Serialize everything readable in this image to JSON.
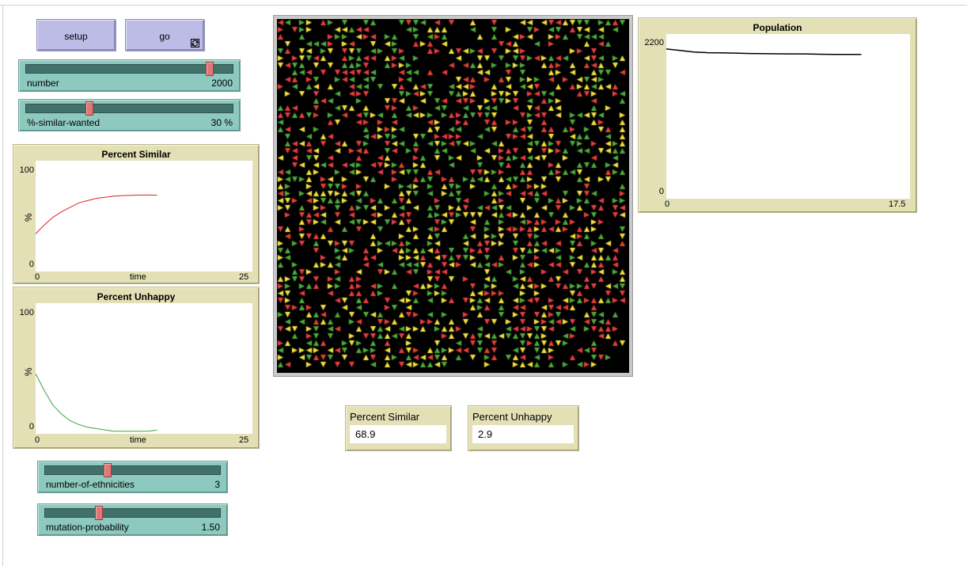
{
  "buttons": {
    "setup_label": "setup",
    "go_label": "go",
    "go_forever_icon": "forever-arrows-icon"
  },
  "sliders": {
    "number": {
      "name": "number",
      "value": "2000",
      "fraction": 0.9
    },
    "similar_wanted": {
      "name": "%-similar-wanted",
      "value": "30 %",
      "fraction": 0.3
    },
    "ethnicities": {
      "name": "number-of-ethnicities",
      "value": "3",
      "fraction": 0.35
    },
    "mutation": {
      "name": "mutation-probability",
      "value": "1.50",
      "fraction": 0.3
    }
  },
  "plots": {
    "percent_similar": {
      "title": "Percent Similar",
      "ylabel": "%",
      "xlabel": "time",
      "ymin": "0",
      "ymax": "100",
      "xmin": "0",
      "xmax": "25",
      "color": "#e02020"
    },
    "percent_unhappy": {
      "title": "Percent Unhappy",
      "ylabel": "%",
      "xlabel": "time",
      "ymin": "0",
      "ymax": "100",
      "xmin": "0",
      "xmax": "25",
      "color": "#3aa33a"
    },
    "population": {
      "title": "Population",
      "ymin": "0",
      "ymax": "2200",
      "xmin": "0",
      "xmax": "17.5",
      "color": "#000000"
    }
  },
  "monitors": {
    "percent_similar": {
      "label": "Percent Similar",
      "value": "68.9"
    },
    "percent_unhappy": {
      "label": "Percent Unhappy",
      "value": "2.9"
    }
  },
  "world": {
    "background": "#000000",
    "turtle_colors": [
      "#e83c3c",
      "#f2e03c",
      "#4caa3c"
    ]
  },
  "chart_data": [
    {
      "type": "line",
      "title": "Percent Similar",
      "xlabel": "time",
      "ylabel": "%",
      "xlim": [
        0,
        25
      ],
      "ylim": [
        0,
        100
      ],
      "series": [
        {
          "color": "#e02020",
          "x": [
            0,
            1,
            2,
            3,
            4,
            5,
            6,
            7,
            8,
            9,
            10,
            11,
            12,
            13,
            14
          ],
          "y": [
            34,
            42,
            49,
            54,
            58,
            62,
            64,
            66,
            67,
            68,
            68.5,
            68.8,
            69,
            69,
            68.9
          ]
        }
      ]
    },
    {
      "type": "line",
      "title": "Percent Unhappy",
      "xlabel": "time",
      "ylabel": "%",
      "xlim": [
        0,
        25
      ],
      "ylim": [
        0,
        100
      ],
      "series": [
        {
          "color": "#3aa33a",
          "x": [
            0,
            1,
            2,
            3,
            4,
            5,
            6,
            7,
            8,
            9,
            10,
            11,
            12,
            13,
            14
          ],
          "y": [
            46,
            33,
            22,
            15,
            10,
            7,
            5,
            4,
            3,
            2,
            2,
            2,
            2,
            2,
            2.9
          ]
        }
      ]
    },
    {
      "type": "line",
      "title": "Population",
      "xlim": [
        0,
        17.5
      ],
      "ylim": [
        0,
        2200
      ],
      "series": [
        {
          "color": "#000000",
          "x": [
            0,
            1,
            2,
            3,
            4,
            5,
            6,
            7,
            8,
            9,
            10,
            11,
            12,
            13,
            14
          ],
          "y": [
            2000,
            1980,
            1960,
            1950,
            1948,
            1945,
            1940,
            1938,
            1936,
            1935,
            1934,
            1930,
            1928,
            1928,
            1928
          ]
        }
      ]
    }
  ]
}
